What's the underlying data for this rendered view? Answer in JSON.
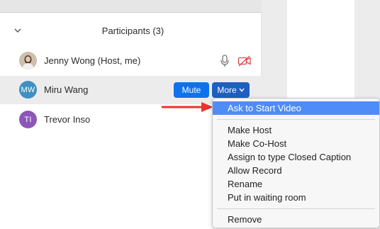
{
  "panel": {
    "title": "Participants (3)"
  },
  "participants": [
    {
      "name": "Jenny Wong (Host, me)",
      "initials": "",
      "avatar_color": "#c9b6a6"
    },
    {
      "name": "Miru Wang",
      "initials": "MW",
      "avatar_color": "#3f8fc1"
    },
    {
      "name": "Trevor Inso",
      "initials": "TI",
      "avatar_color": "#8d56b8"
    }
  ],
  "hover_row": {
    "mute_label": "Mute",
    "more_label": "More"
  },
  "menu": {
    "items": [
      "Ask to Start Video",
      "Make Host",
      "Make Co-Host",
      "Assign to type Closed Caption",
      "Allow Record",
      "Rename",
      "Put in waiting room",
      "Remove"
    ],
    "highlighted": "Ask to Start Video"
  },
  "colors": {
    "accent": "#0e72ed",
    "menu_highlight": "#4f8cf7",
    "video_off": "#e0454a",
    "arrow": "#e8352d"
  }
}
